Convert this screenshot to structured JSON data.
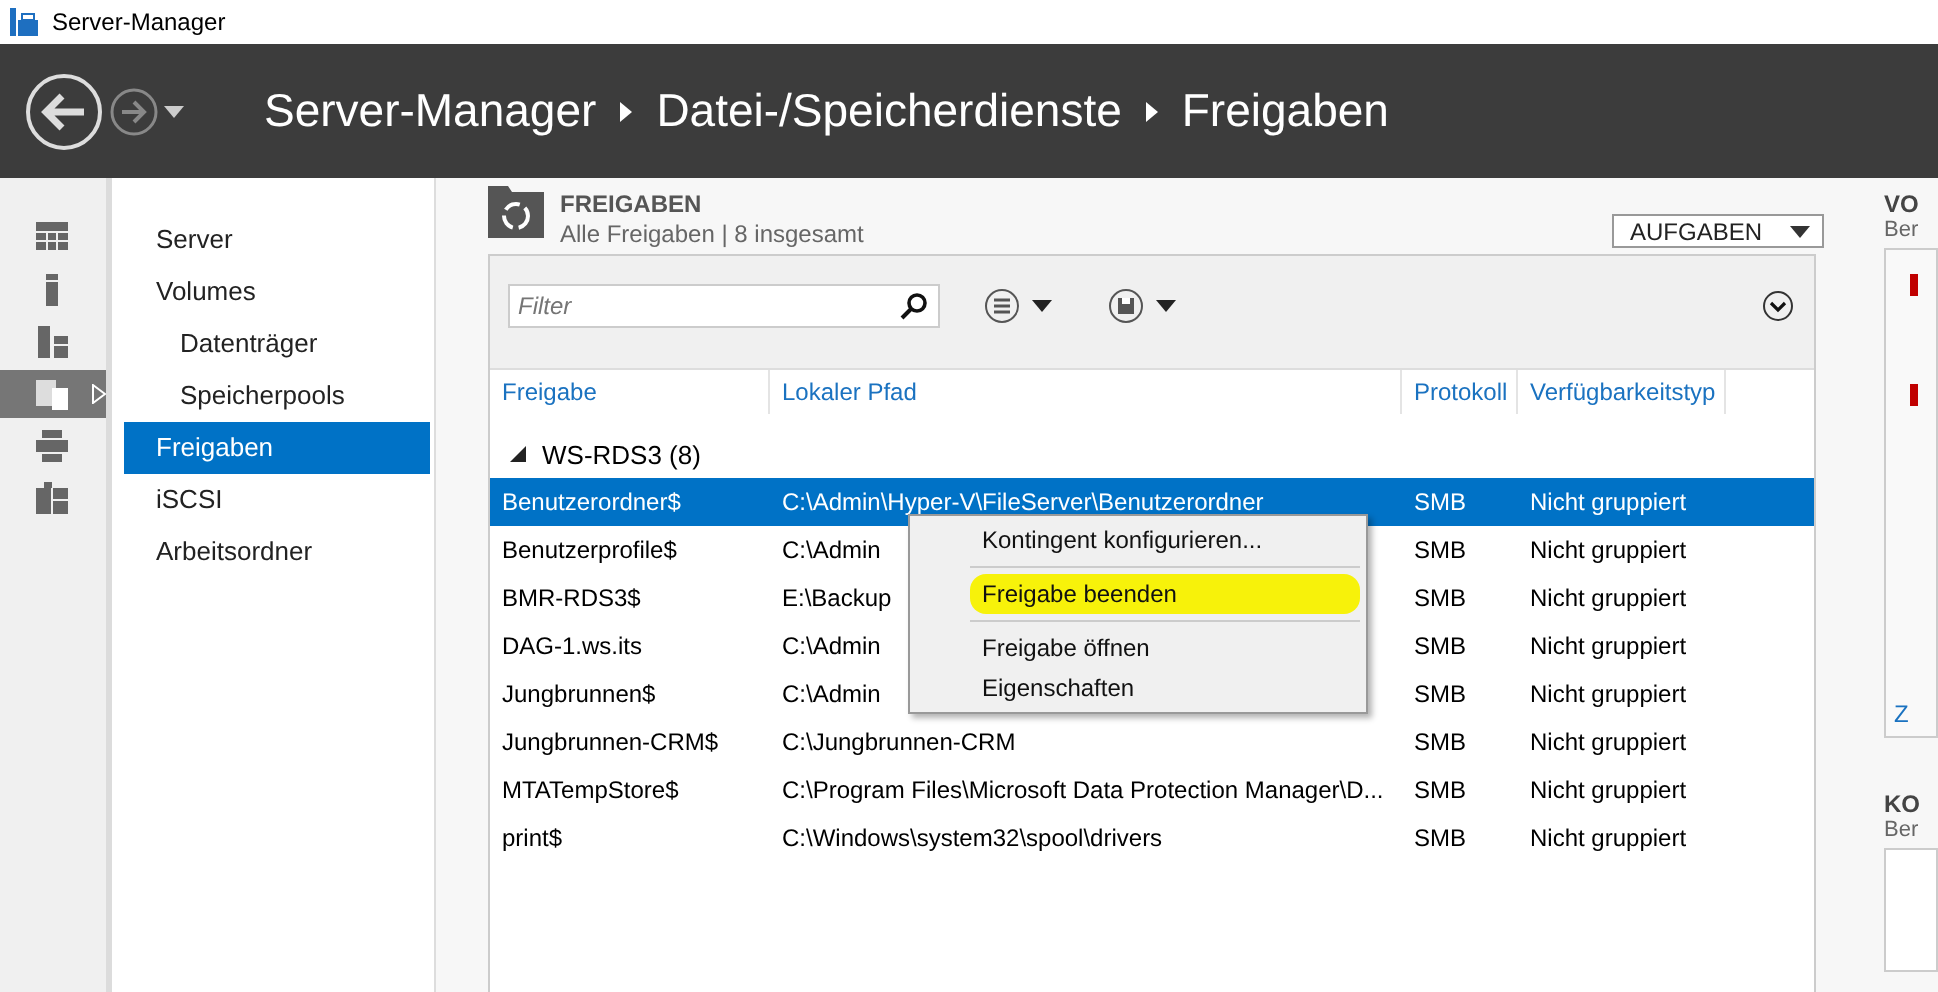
{
  "window": {
    "title": "Server-Manager"
  },
  "breadcrumb": [
    "Server-Manager",
    "Datei-/Speicherdienste",
    "Freigaben"
  ],
  "rail": [
    {
      "kind": "dashboard",
      "selected": false
    },
    {
      "kind": "server",
      "selected": false
    },
    {
      "kind": "servers",
      "selected": false
    },
    {
      "kind": "storage",
      "selected": true
    },
    {
      "kind": "printer",
      "selected": false
    },
    {
      "kind": "tiles",
      "selected": false
    }
  ],
  "nav": [
    {
      "label": "Server",
      "selected": false
    },
    {
      "label": "Volumes",
      "selected": false,
      "children": [
        {
          "label": "Datenträger",
          "selected": false
        },
        {
          "label": "Speicherpools",
          "selected": false
        }
      ]
    },
    {
      "label": "Freigaben",
      "selected": true
    },
    {
      "label": "iSCSI",
      "selected": false
    },
    {
      "label": "Arbeitsordner",
      "selected": false
    }
  ],
  "shares": {
    "title": "FREIGABEN",
    "subtitle": "Alle Freigaben | 8 insgesamt",
    "tasks_button": "AUFGABEN",
    "filter": {
      "placeholder": "Filter"
    },
    "columns": [
      "Freigabe",
      "Lokaler Pfad",
      "Protokoll",
      "Verfügbarkeitstyp"
    ],
    "group": {
      "label": "WS-RDS3 (8)",
      "expanded": true
    },
    "rows": [
      {
        "cells": [
          "Benutzerordner$",
          "C:\\Admin\\Hyper-V\\FileServer\\Benutzerordner",
          "SMB",
          "Nicht gruppiert"
        ],
        "selected": true
      },
      {
        "cells": [
          "Benutzerprofile$",
          "C:\\Admin",
          "SMB",
          "Nicht gruppiert"
        ],
        "selected": false
      },
      {
        "cells": [
          "BMR-RDS3$",
          "E:\\Backup",
          "SMB",
          "Nicht gruppiert"
        ],
        "selected": false
      },
      {
        "cells": [
          "DAG-1.ws.its",
          "C:\\Admin",
          "SMB",
          "Nicht gruppiert"
        ],
        "selected": false
      },
      {
        "cells": [
          "Jungbrunnen$",
          "C:\\Admin",
          "SMB",
          "Nicht gruppiert"
        ],
        "selected": false
      },
      {
        "cells": [
          "Jungbrunnen-CRM$",
          "C:\\Jungbrunnen-CRM",
          "SMB",
          "Nicht gruppiert"
        ],
        "selected": false
      },
      {
        "cells": [
          "MTATempStore$",
          "C:\\Program Files\\Microsoft Data Protection Manager\\D...",
          "SMB",
          "Nicht gruppiert"
        ],
        "selected": false
      },
      {
        "cells": [
          "print$",
          "C:\\Windows\\system32\\spool\\drivers",
          "SMB",
          "Nicht gruppiert"
        ],
        "selected": false
      }
    ]
  },
  "context_menu": [
    {
      "label": "Kontingent konfigurieren...",
      "highlighted": false,
      "separator_after": true
    },
    {
      "label": "Freigabe beenden",
      "highlighted": true,
      "separator_after": true
    },
    {
      "label": "Freigabe öffnen",
      "highlighted": false,
      "separator_after": false
    },
    {
      "label": "Eigenschaften",
      "highlighted": false,
      "separator_after": false
    }
  ],
  "side_panels": [
    {
      "title": "VO",
      "subtitle": "Ber",
      "alerts": [
        {
          "color": "#c00000"
        },
        {
          "color": "#c00000"
        }
      ],
      "link": "Z"
    },
    {
      "title": "KO",
      "subtitle": "Ber"
    }
  ]
}
